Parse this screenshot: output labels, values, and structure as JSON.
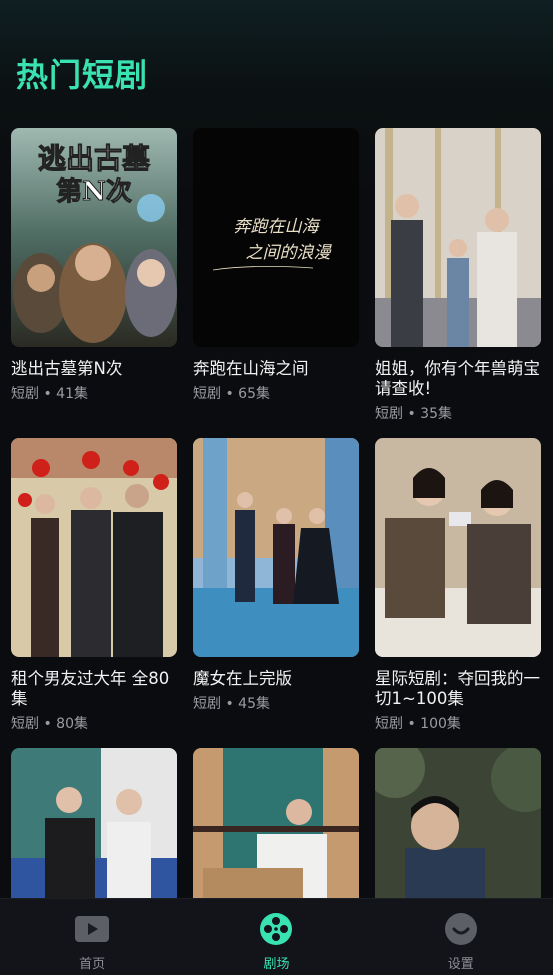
{
  "header": {
    "title": "热门短剧"
  },
  "posters": {
    "p1": {
      "text_line1": "逃出古墓",
      "text_line2": "第N次"
    },
    "p2": {
      "text_line1": "奔跑在山海",
      "text_line2": "之间的浪漫"
    }
  },
  "dramas": [
    {
      "title": "逃出古墓第N次",
      "meta": "短剧 • 41集"
    },
    {
      "title": "奔跑在山海之间",
      "meta": "短剧 • 65集"
    },
    {
      "title": "姐姐，你有个年兽萌宝请查收!",
      "meta": "短剧 • 35集"
    },
    {
      "title": "租个男友过大年 全80集",
      "meta": "短剧 • 80集"
    },
    {
      "title": "魔女在上完版",
      "meta": "短剧 • 45集"
    },
    {
      "title": "星际短剧：夺回我的一切1~100集",
      "meta": "短剧 • 100集"
    }
  ],
  "tabbar": {
    "items": [
      {
        "label": "首页",
        "icon": "play-icon"
      },
      {
        "label": "剧场",
        "icon": "film-reel-icon",
        "active": true
      },
      {
        "label": "设置",
        "icon": "smile-icon"
      }
    ]
  },
  "colors": {
    "accent": "#39e2b0",
    "background": "#0b0c0f",
    "meta": "#9a9ca3"
  }
}
